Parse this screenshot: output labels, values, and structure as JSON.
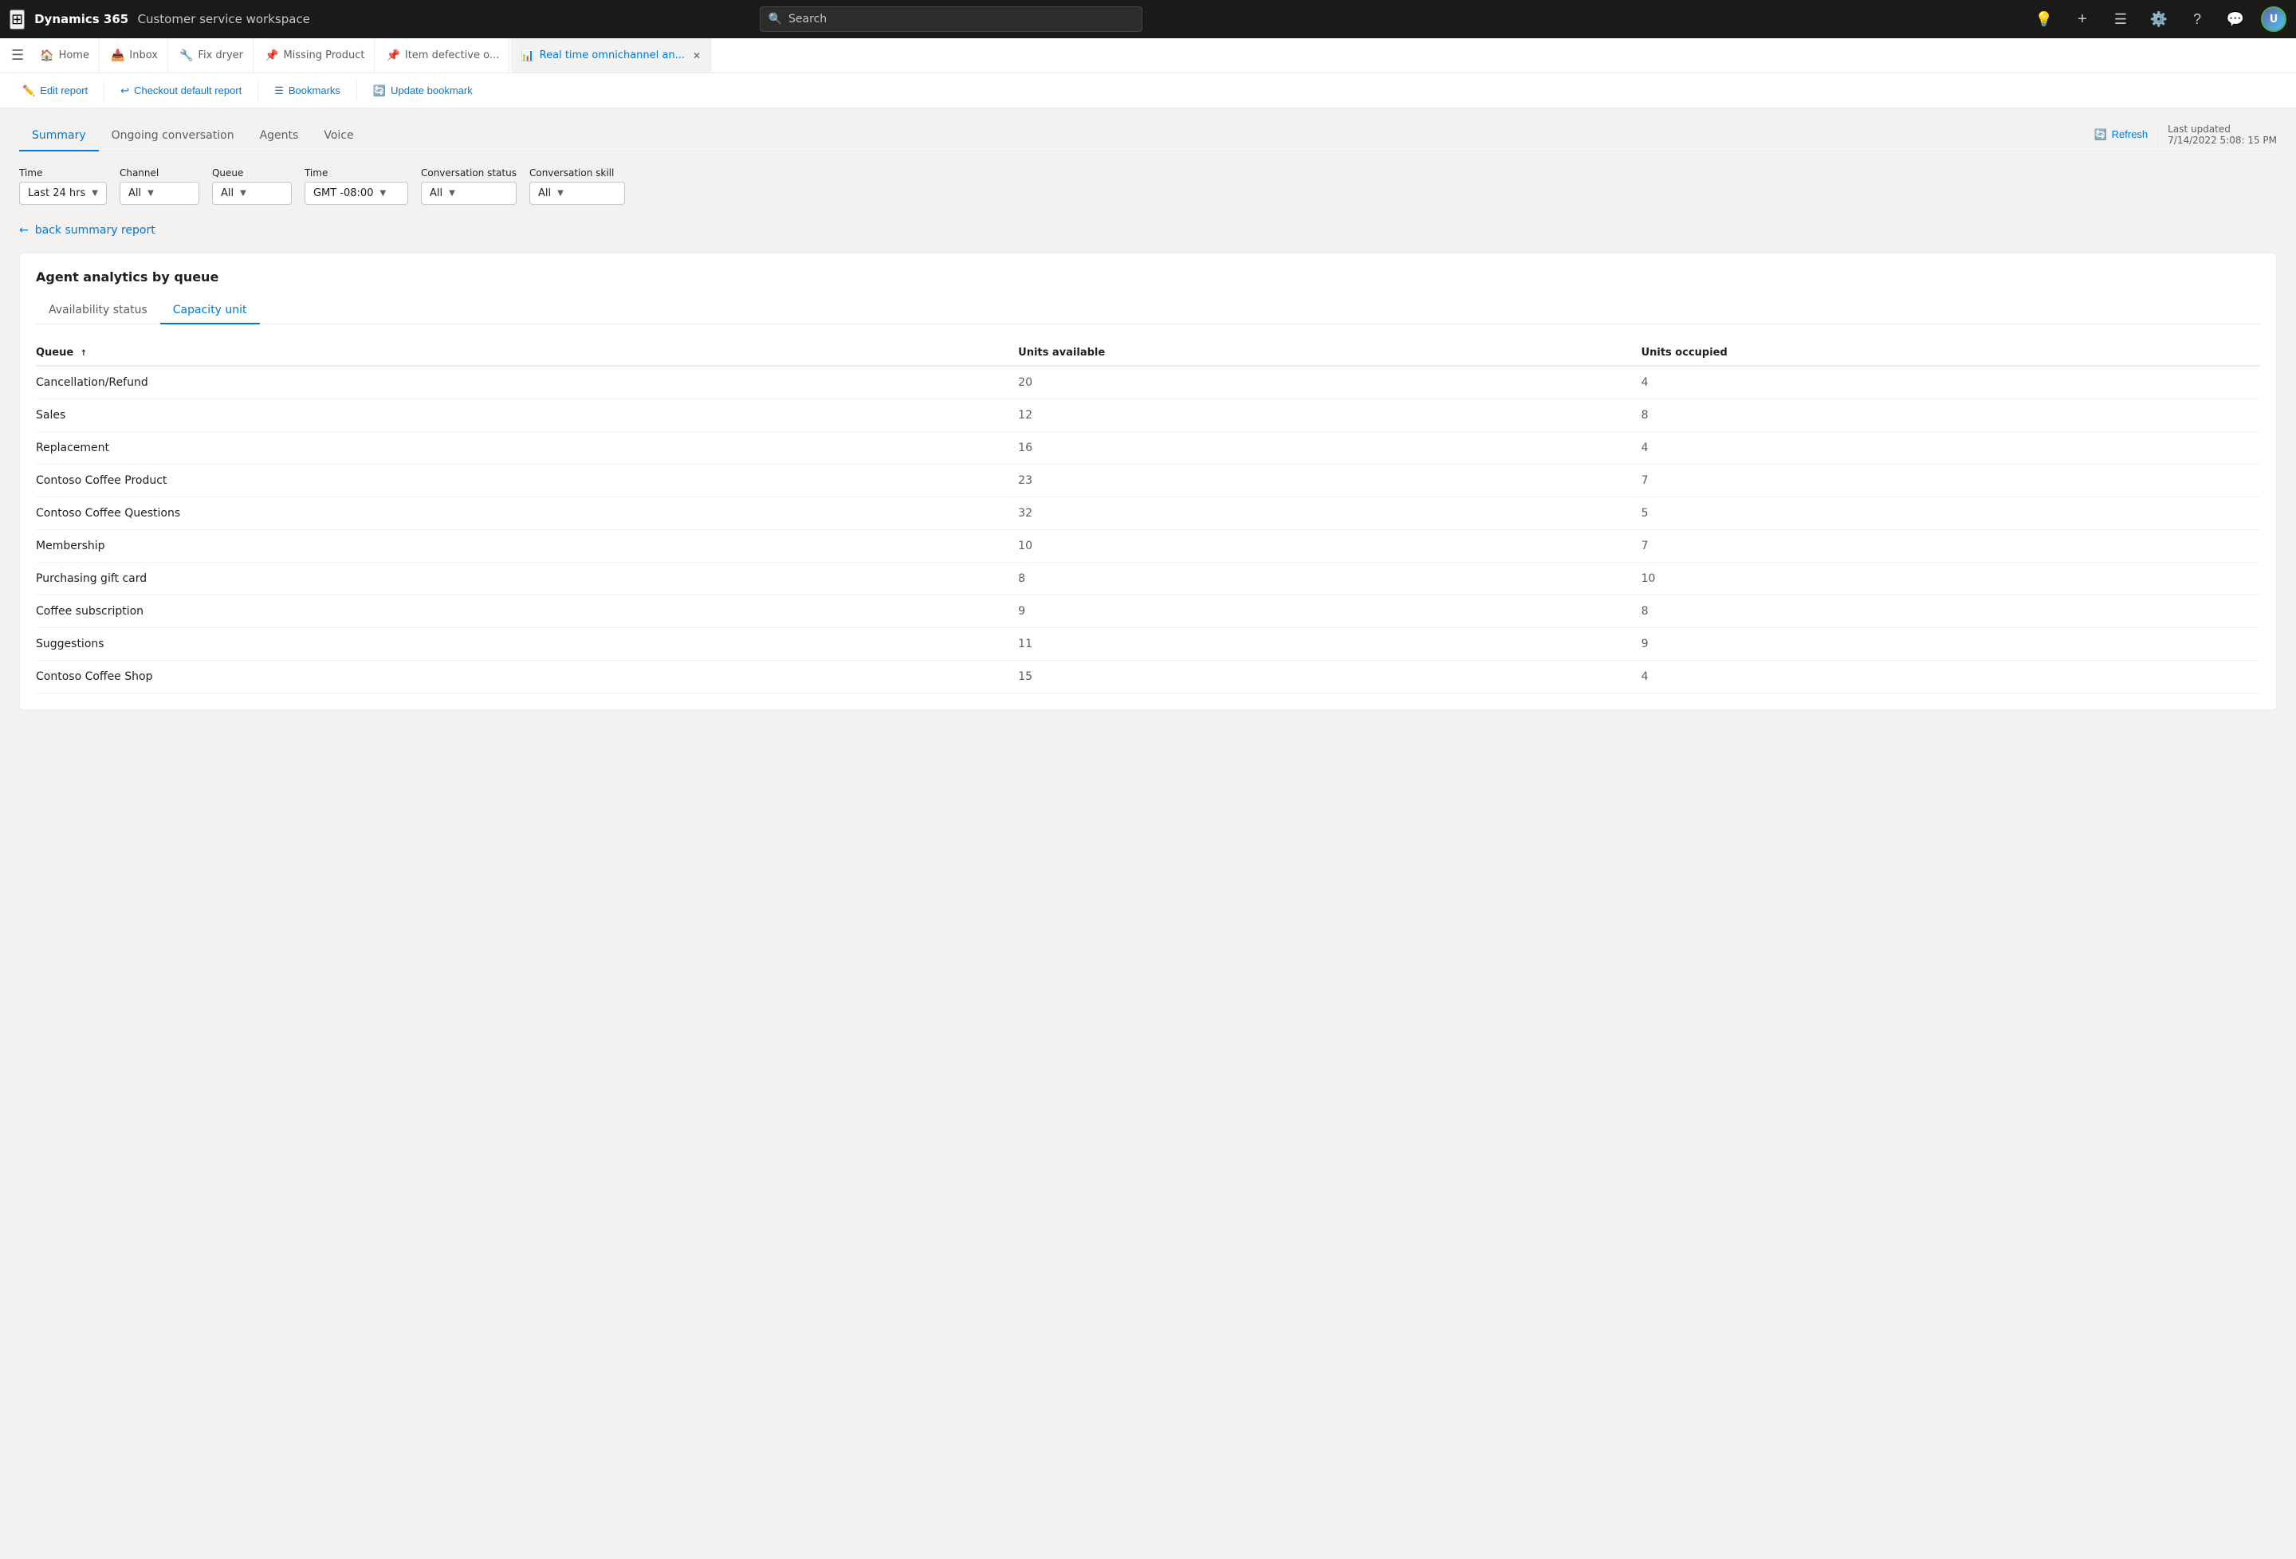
{
  "topNav": {
    "appName": "Dynamics 365",
    "appSub": "Customer service workspace",
    "searchPlaceholder": "Search"
  },
  "tabs": [
    {
      "id": "home",
      "label": "Home",
      "icon": "🏠",
      "active": false,
      "closable": false
    },
    {
      "id": "inbox",
      "label": "Inbox",
      "icon": "📥",
      "active": false,
      "closable": false
    },
    {
      "id": "fix-dryer",
      "label": "Fix dryer",
      "icon": "🔧",
      "active": false,
      "closable": true
    },
    {
      "id": "missing-product",
      "label": "Missing Product",
      "icon": "📌",
      "active": false,
      "closable": true
    },
    {
      "id": "item-defective",
      "label": "Item defective o...",
      "icon": "📌",
      "active": false,
      "closable": true
    },
    {
      "id": "real-time",
      "label": "Real time omnichannel an...",
      "icon": "📊",
      "active": true,
      "closable": true
    }
  ],
  "toolbar": {
    "editReport": "Edit report",
    "checkoutDefault": "Checkout default report",
    "bookmarks": "Bookmarks",
    "updateBookmark": "Update bookmark"
  },
  "subTabs": [
    {
      "id": "summary",
      "label": "Summary",
      "active": true
    },
    {
      "id": "ongoing",
      "label": "Ongoing conversation",
      "active": false
    },
    {
      "id": "agents",
      "label": "Agents",
      "active": false
    },
    {
      "id": "voice",
      "label": "Voice",
      "active": false
    }
  ],
  "refreshLabel": "Refresh",
  "lastUpdated": "Last updated",
  "lastUpdatedTime": "7/14/2022 5:08: 15 PM",
  "filters": [
    {
      "id": "time1",
      "label": "Time",
      "value": "Last 24 hrs"
    },
    {
      "id": "channel",
      "label": "Channel",
      "value": "All"
    },
    {
      "id": "queue",
      "label": "Queue",
      "value": "All"
    },
    {
      "id": "time2",
      "label": "Time",
      "value": "GMT -08:00"
    },
    {
      "id": "conv-status",
      "label": "Conversation status",
      "value": "All"
    },
    {
      "id": "conv-skill",
      "label": "Conversation skill",
      "value": "All"
    }
  ],
  "backLink": "back summary report",
  "card": {
    "title": "Agent analytics by queue",
    "innerTabs": [
      {
        "id": "availability",
        "label": "Availability status",
        "active": false
      },
      {
        "id": "capacity",
        "label": "Capacity unit",
        "active": true
      }
    ],
    "tableHeaders": [
      {
        "id": "queue",
        "label": "Queue",
        "sortable": true
      },
      {
        "id": "units-available",
        "label": "Units available",
        "sortable": false
      },
      {
        "id": "units-occupied",
        "label": "Units occupied",
        "sortable": false
      }
    ],
    "tableRows": [
      {
        "queue": "Cancellation/Refund",
        "unitsAvailable": "20",
        "unitsOccupied": "4"
      },
      {
        "queue": "Sales",
        "unitsAvailable": "12",
        "unitsOccupied": "8"
      },
      {
        "queue": "Replacement",
        "unitsAvailable": "16",
        "unitsOccupied": "4"
      },
      {
        "queue": "Contoso Coffee Product",
        "unitsAvailable": "23",
        "unitsOccupied": "7"
      },
      {
        "queue": "Contoso Coffee Questions",
        "unitsAvailable": "32",
        "unitsOccupied": "5"
      },
      {
        "queue": "Membership",
        "unitsAvailable": "10",
        "unitsOccupied": "7"
      },
      {
        "queue": "Purchasing gift card",
        "unitsAvailable": "8",
        "unitsOccupied": "10"
      },
      {
        "queue": "Coffee subscription",
        "unitsAvailable": "9",
        "unitsOccupied": "8"
      },
      {
        "queue": "Suggestions",
        "unitsAvailable": "11",
        "unitsOccupied": "9"
      },
      {
        "queue": "Contoso Coffee Shop",
        "unitsAvailable": "15",
        "unitsOccupied": "4"
      }
    ]
  }
}
